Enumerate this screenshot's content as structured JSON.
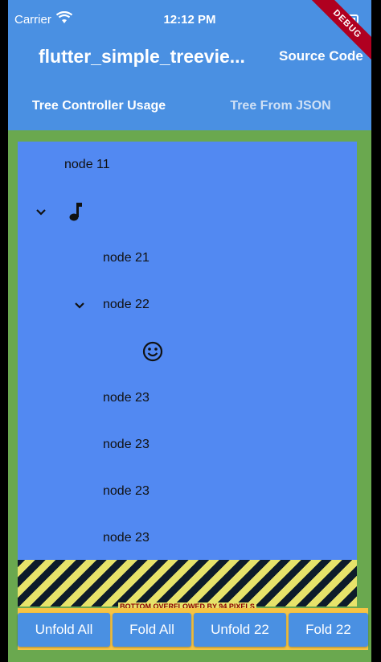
{
  "status_bar": {
    "carrier": "Carrier",
    "time": "12:12 PM"
  },
  "app_bar": {
    "title": "flutter_simple_treevie...",
    "source_code": "Source Code",
    "debug_banner": "DEBUG"
  },
  "tabs": [
    {
      "label": "Tree Controller Usage"
    },
    {
      "label": "Tree From JSON"
    }
  ],
  "tree": {
    "node_11": "node 11",
    "node_21": "node 21",
    "node_22": "node 22",
    "node_23": [
      "node 23",
      "node 23",
      "node 23",
      "node 23"
    ]
  },
  "overflow_warning": "BOTTOM OVERFLOWED BY 94 PIXELS",
  "buttons": {
    "unfold_all": "Unfold All",
    "fold_all": "Fold All",
    "unfold_22": "Unfold 22",
    "fold_22": "Fold 22"
  },
  "colors": {
    "app_bar": "#4a90e2",
    "tree_background": "#5289f2",
    "page_background": "#6aa84f",
    "button_bar": "#f6c445"
  },
  "icons": {
    "music_node": "music-note-icon",
    "emoji_node": "smiley-icon",
    "expanded": "chevron-down-icon"
  }
}
